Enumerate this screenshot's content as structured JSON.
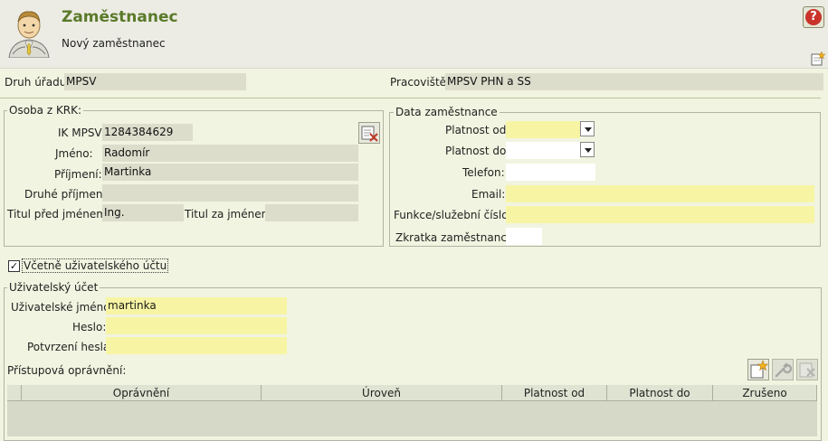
{
  "header": {
    "title": "Zaměstnanec",
    "subtitle": "Nový zaměstnanec"
  },
  "top": {
    "druh_uradu_label": "Druh úřadu:",
    "druh_uradu_value": "MPSV",
    "pracoviste_label": "Pracoviště:",
    "pracoviste_value": "MPSV PHN a SS"
  },
  "osoba": {
    "legend": "Osoba z KRK:",
    "ik_label": "IK MPSV:",
    "ik_value": "1284384629",
    "jmeno_label": "Jméno:",
    "jmeno_value": "Radomír",
    "prijmeni_label": "Příjmení:",
    "prijmeni_value": "Martinka",
    "druhe_label": "Druhé příjmení:",
    "druhe_value": "",
    "titul_pred_label": "Titul před jménem:",
    "titul_pred_value": "Ing.",
    "titul_za_label": "Titul za jménem:",
    "titul_za_value": ""
  },
  "data_zam": {
    "legend": "Data zaměstnance",
    "platnost_od_label": "Platnost od:",
    "platnost_od_value": "",
    "platnost_do_label": "Platnost do:",
    "platnost_do_value": "",
    "telefon_label": "Telefon:",
    "telefon_value": "",
    "email_label": "Email:",
    "email_value": "",
    "funkce_label": "Funkce/služební číslo:",
    "funkce_value": "",
    "zkratka_label": "Zkratka zaměstnance:",
    "zkratka_value": ""
  },
  "ucet_checkbox": {
    "label": "Včetně uživatelského účtu",
    "checked_glyph": "✓"
  },
  "ucet": {
    "legend": "Uživatelský účet",
    "jmeno_label": "Uživatelské jméno:",
    "jmeno_value": "martinka",
    "heslo_label": "Heslo:",
    "heslo_value": "",
    "potvrzeni_label": "Potvrzení hesla:",
    "potvrzeni_value": ""
  },
  "opravneni": {
    "label": "Přístupová oprávnění:",
    "columns": [
      "Oprávnění",
      "Úroveň",
      "Platnost od",
      "Platnost do",
      "Zrušeno"
    ]
  },
  "icons": {
    "help": "help-icon",
    "new": "new-record-icon",
    "edit_person": "edit-person-icon",
    "add": "add-icon",
    "edit": "wrench-icon",
    "delete": "delete-icon"
  }
}
